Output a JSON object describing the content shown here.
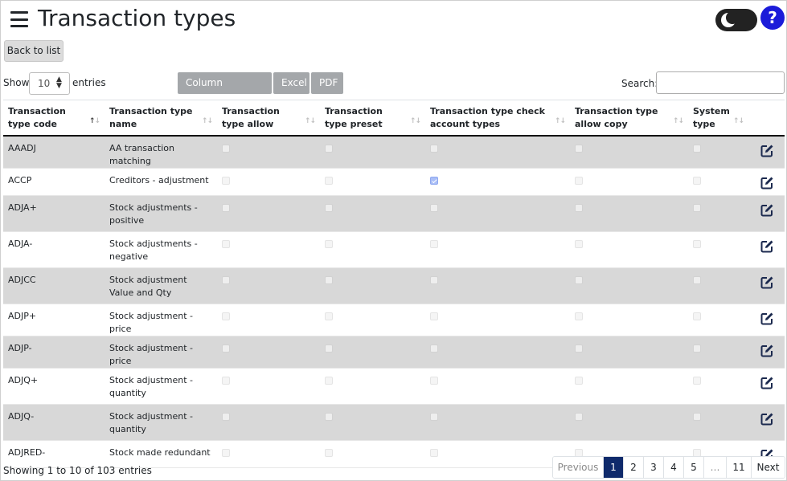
{
  "header": {
    "title": "Transaction types",
    "help_label": "?"
  },
  "nav": {
    "back_label": "Back to list"
  },
  "controls": {
    "show_label": "Show",
    "entries_value": "10",
    "entries_label": "entries",
    "buttons": {
      "column_visibility": "Column Visibility",
      "excel": "Excel",
      "pdf": "PDF"
    },
    "search_label": "Search:",
    "search_value": ""
  },
  "table": {
    "columns": [
      "Transaction type code",
      "Transaction type name",
      "Transaction type allow",
      "Transaction type preset",
      "Transaction type check account types",
      "Transaction type allow copy",
      "System type"
    ],
    "rows": [
      {
        "code": "AAADJ",
        "name": "AA transaction matching",
        "allow": false,
        "preset": false,
        "check_account_types": false,
        "allow_copy": false,
        "system_type": false
      },
      {
        "code": "ACCP",
        "name": "Creditors - adjustment",
        "allow": false,
        "preset": false,
        "check_account_types": true,
        "allow_copy": false,
        "system_type": false
      },
      {
        "code": "ADJA+",
        "name": "Stock adjustments - positive",
        "allow": false,
        "preset": false,
        "check_account_types": false,
        "allow_copy": false,
        "system_type": false
      },
      {
        "code": "ADJA-",
        "name": "Stock adjustments - negative",
        "allow": false,
        "preset": false,
        "check_account_types": false,
        "allow_copy": false,
        "system_type": false
      },
      {
        "code": "ADJCC",
        "name": "Stock adjustment Value and Qty",
        "allow": false,
        "preset": false,
        "check_account_types": false,
        "allow_copy": false,
        "system_type": false
      },
      {
        "code": "ADJP+",
        "name": "Stock adjustment - price",
        "allow": false,
        "preset": false,
        "check_account_types": false,
        "allow_copy": false,
        "system_type": false
      },
      {
        "code": "ADJP-",
        "name": "Stock adjustment - price",
        "allow": false,
        "preset": false,
        "check_account_types": false,
        "allow_copy": false,
        "system_type": false
      },
      {
        "code": "ADJQ+",
        "name": "Stock adjustment - quantity",
        "allow": false,
        "preset": false,
        "check_account_types": false,
        "allow_copy": false,
        "system_type": false
      },
      {
        "code": "ADJQ-",
        "name": "Stock adjustment - quantity",
        "allow": false,
        "preset": false,
        "check_account_types": false,
        "allow_copy": false,
        "system_type": false
      },
      {
        "code": "ADJRED-",
        "name": "Stock made redundant",
        "allow": false,
        "preset": false,
        "check_account_types": false,
        "allow_copy": false,
        "system_type": false
      }
    ]
  },
  "footer": {
    "info": "Showing 1 to 10 of 103 entries",
    "pagination": {
      "previous": "Previous",
      "pages": [
        "1",
        "2",
        "3",
        "4",
        "5"
      ],
      "ellipsis": "…",
      "last": "11",
      "next": "Next",
      "active_page": "1"
    }
  },
  "icons": {
    "menu": "hamburger-menu-icon",
    "theme": "moon-icon",
    "help": "question-icon",
    "edit": "edit-icon"
  },
  "colors": {
    "active_page": "#0f2a6b",
    "help_button": "#1b1bd9",
    "striped_row": "#d8d8d8",
    "toolbar_button": "#a4a7aa"
  }
}
